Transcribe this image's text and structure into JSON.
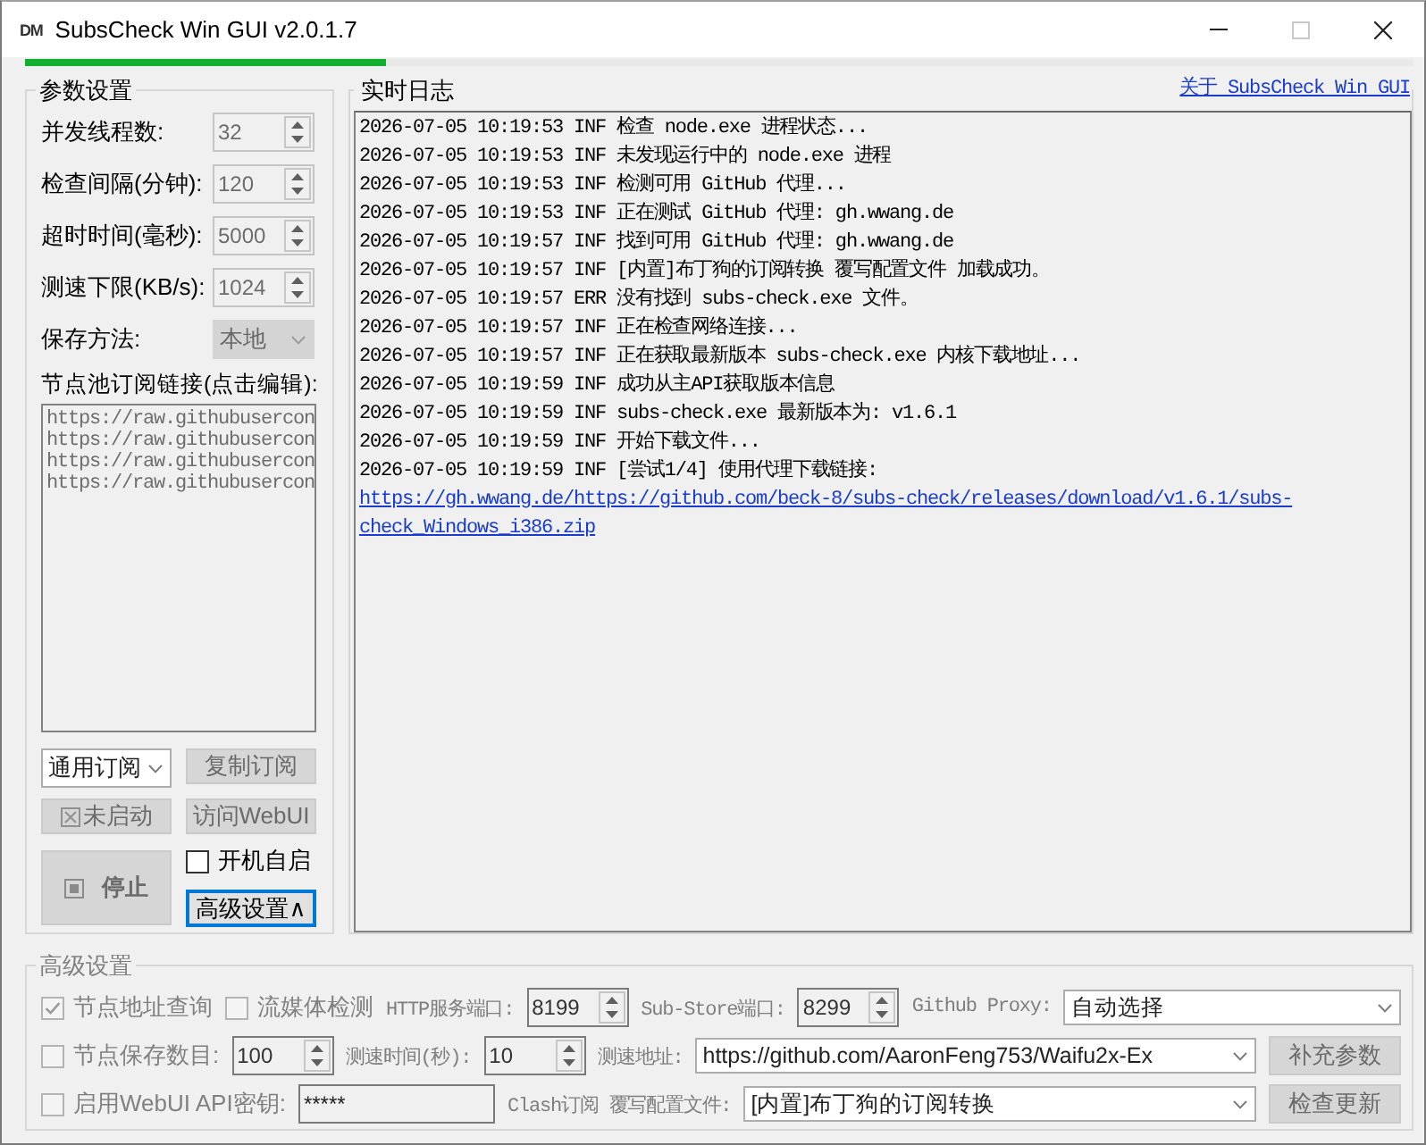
{
  "window": {
    "logo": "DM",
    "title": "SubsCheck Win GUI v2.0.1.7",
    "controls": [
      {
        "kind": "minimize",
        "disabled": false
      },
      {
        "kind": "maximize",
        "disabled": true
      },
      {
        "kind": "close",
        "disabled": false
      }
    ]
  },
  "progress": {
    "level": 0.26
  },
  "params": {
    "title": "参数设置",
    "fields": [
      {
        "kind": "spin",
        "label": "并发线程数:",
        "value": "32",
        "disabled": true
      },
      {
        "kind": "spin",
        "label": "检查间隔(分钟):",
        "value": "120",
        "disabled": true
      },
      {
        "kind": "spin",
        "label": "超时时间(毫秒):",
        "value": "5000",
        "disabled": true
      },
      {
        "kind": "spin",
        "label": "测速下限(KB/s):",
        "value": "1024",
        "disabled": true
      },
      {
        "kind": "combo",
        "label": "保存方法:",
        "value": "本地",
        "disabled": true
      }
    ],
    "subscriptions": {
      "label": "节点池订阅链接(点击编辑):",
      "lines": [
        "https://raw.githubusercon",
        "https://raw.githubusercon",
        "https://raw.githubusercon",
        "https://raw.githubusercon"
      ],
      "disabled": true
    },
    "sub_type": {
      "value": "通用订阅",
      "disabled": false
    },
    "copy_button": {
      "label": "复制订阅",
      "disabled": true
    },
    "status_button": {
      "label": "未启动",
      "disabled": true
    },
    "webui_button": {
      "label": "访问WebUI",
      "disabled": true
    },
    "stop_button": {
      "label": "停止",
      "disabled": true
    },
    "autostart": {
      "label": "开机自启",
      "checked": false
    },
    "advanced_button": {
      "label": "高级设置∧",
      "focused": true
    }
  },
  "log": {
    "title": "实时日志",
    "about_link": "关于 SubsCheck Win GUI",
    "entries": [
      {
        "kind": "text",
        "text": "2026-07-05 10:19:53 INF 检查 node.exe 进程状态..."
      },
      {
        "kind": "text",
        "text": "2026-07-05 10:19:53 INF 未发现运行中的 node.exe 进程"
      },
      {
        "kind": "text",
        "text": "2026-07-05 10:19:53 INF 检测可用 GitHub 代理..."
      },
      {
        "kind": "text",
        "text": "2026-07-05 10:19:53 INF 正在测试 GitHub 代理: gh.wwang.de"
      },
      {
        "kind": "text",
        "text": "2026-07-05 10:19:57 INF 找到可用 GitHub 代理: gh.wwang.de"
      },
      {
        "kind": "text",
        "text": "2026-07-05 10:19:57 INF [内置]布丁狗的订阅转换 覆写配置文件 加载成功。"
      },
      {
        "kind": "text",
        "text": "2026-07-05 10:19:57 ERR 没有找到 subs-check.exe 文件。"
      },
      {
        "kind": "text",
        "text": "2026-07-05 10:19:57 INF 正在检查网络连接..."
      },
      {
        "kind": "text",
        "text": "2026-07-05 10:19:57 INF 正在获取最新版本 subs-check.exe 内核下载地址..."
      },
      {
        "kind": "text",
        "text": "2026-07-05 10:19:59 INF 成功从主API获取版本信息"
      },
      {
        "kind": "text",
        "text": "2026-07-05 10:19:59 INF subs-check.exe 最新版本为: v1.6.1"
      },
      {
        "kind": "text",
        "text": "2026-07-05 10:19:59 INF 开始下载文件..."
      },
      {
        "kind": "text",
        "text": "2026-07-05 10:19:59 INF [尝试1/4] 使用代理下载链接:"
      },
      {
        "kind": "link",
        "text": "https://gh.wwang.de/https://github.com/beck-8/subs-check/releases/download/v1.6.1/subs-check_Windows_i386.zip"
      }
    ]
  },
  "advanced": {
    "title": "高级设置",
    "disabled": true,
    "rows": [
      {
        "items": [
          {
            "kind": "checkbox",
            "label": "节点地址查询",
            "checked": true
          },
          {
            "kind": "checkbox",
            "label": "流媒体检测",
            "checked": false
          },
          {
            "kind": "label",
            "text": "HTTP服务端口:"
          },
          {
            "kind": "spin",
            "value": "8199"
          },
          {
            "kind": "label",
            "text": "Sub-Store端口:"
          },
          {
            "kind": "spin",
            "value": "8299"
          },
          {
            "kind": "label",
            "text": "Github Proxy:"
          },
          {
            "kind": "combo",
            "value": "自动选择"
          }
        ]
      },
      {
        "items": [
          {
            "kind": "checkbox",
            "label": "节点保存数目:",
            "checked": false
          },
          {
            "kind": "spin",
            "value": "100"
          },
          {
            "kind": "label",
            "text": "测速时间(秒):"
          },
          {
            "kind": "spin",
            "value": "10"
          },
          {
            "kind": "label",
            "text": "测速地址:"
          },
          {
            "kind": "combo",
            "value": "https://github.com/AaronFeng753/Waifu2x-Ex"
          },
          {
            "kind": "button",
            "label": "补充参数",
            "disabled": true
          }
        ]
      },
      {
        "items": [
          {
            "kind": "checkbox",
            "label": "启用WebUI API密钥:",
            "checked": false
          },
          {
            "kind": "input",
            "value": "*****"
          },
          {
            "kind": "label",
            "text": "Clash订阅 覆写配置文件:"
          },
          {
            "kind": "combo",
            "value": "[内置]布丁狗的订阅转换"
          },
          {
            "kind": "button",
            "label": "检查更新",
            "disabled": true
          }
        ]
      }
    ]
  }
}
